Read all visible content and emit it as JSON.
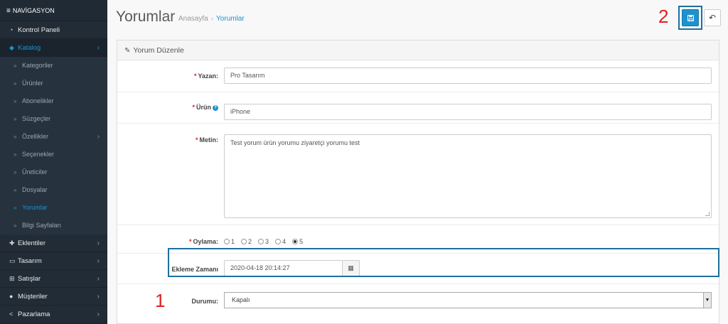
{
  "sidebar": {
    "header": "NAVİGASYON",
    "items": [
      {
        "label": "Kontrol Paneli",
        "icon": "dashboard-icon"
      },
      {
        "label": "Katalog",
        "icon": "tag-icon",
        "active": true
      },
      {
        "label": "Eklentiler",
        "icon": "puzzle-icon"
      },
      {
        "label": "Tasarım",
        "icon": "monitor-icon"
      },
      {
        "label": "Satışlar",
        "icon": "cart-icon"
      },
      {
        "label": "Müşteriler",
        "icon": "user-icon"
      },
      {
        "label": "Pazarlama",
        "icon": "share-icon"
      }
    ],
    "catalog_sub": [
      "Kategoriler",
      "Ürünler",
      "Abonelikler",
      "Süzgeçler",
      "Özellikler",
      "Seçenekler",
      "Üreticiler",
      "Dosyalar",
      "Yorumlar",
      "Bilgi Sayfaları"
    ]
  },
  "header": {
    "title": "Yorumlar",
    "breadcrumb": {
      "home": "Anasayfa",
      "sep": "›",
      "current": "Yorumlar"
    }
  },
  "annotations": {
    "marker1": "1",
    "marker2": "2"
  },
  "panel": {
    "title": "Yorum Düzenle",
    "fields": {
      "author_label": "Yazan:",
      "author_value": "Pro Tasarım",
      "product_label": "Ürün",
      "product_value": "iPhone",
      "text_label": "Metin:",
      "text_value": "Test yorum ürün yorumu ziyaretçi yorumu test",
      "rating_label": "Oylama:",
      "rating_options": [
        "1",
        "2",
        "3",
        "4",
        "5"
      ],
      "rating_selected": "5",
      "date_label": "Ekleme Zamanı",
      "date_value": "2020-04-18 20:14:27",
      "status_label": "Durumu:",
      "status_value": "Kapalı"
    }
  },
  "colors": {
    "accent": "#1e91cf",
    "sidebar_bg": "#222c36",
    "required": "#e02020",
    "highlight": "#1e6f9e"
  }
}
